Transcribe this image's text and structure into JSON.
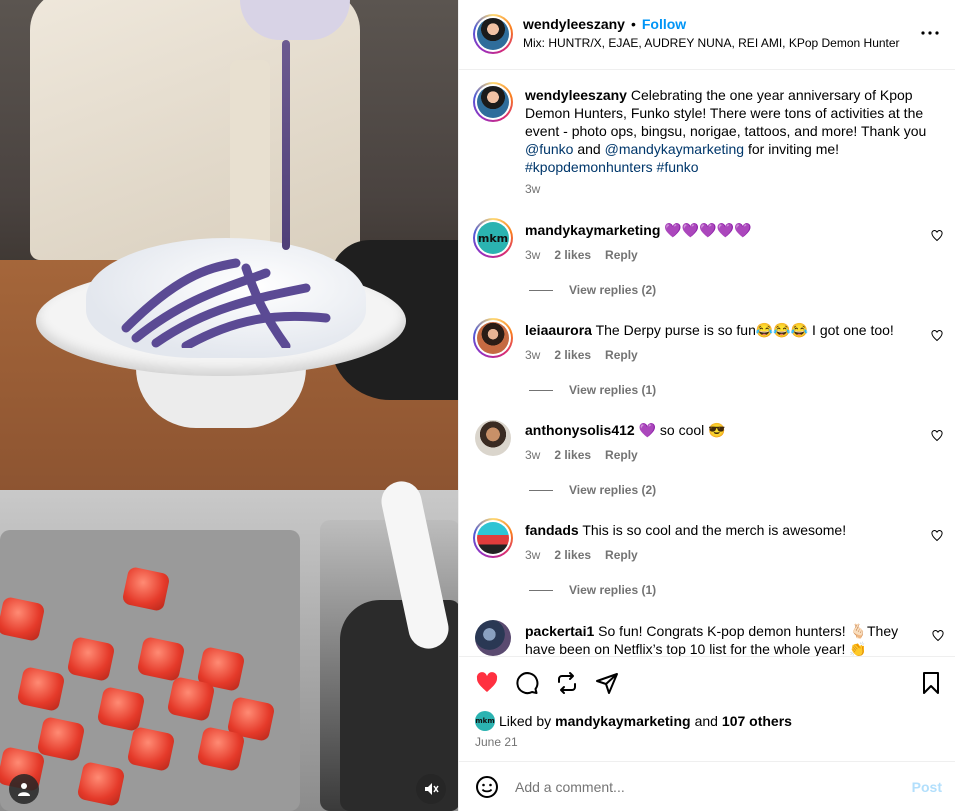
{
  "media": {
    "user_icon": "user-icon",
    "mute_icon": "speaker-muted-icon"
  },
  "header": {
    "username": "wendyleeszany",
    "dot": "•",
    "follow": "Follow",
    "audio": "Mix: HUNTR/X, EJAE, AUDREY NUNA, REI AMI, KPop Demon Hunter",
    "more_icon": "more-icon"
  },
  "caption": {
    "username": "wendyleeszany",
    "text1": "Celebrating the one year anniversary of Kpop Demon Hunters, Funko style! There were tons of activities at the event - photo ops, bingsu, norigae, tattoos, and more! Thank you ",
    "mention1": "@funko",
    "and": " and ",
    "mention2": "@mandykaymarketing",
    "text2": " for inviting me!",
    "tag1": "#kpopdemonhunters",
    "tag2": "#funko",
    "time": "3w"
  },
  "comments": [
    {
      "username": "mandykaymarketing",
      "text": "💜💜💜💜💜",
      "time": "3w",
      "likes": "2 likes",
      "reply": "Reply",
      "replies": "View replies (2)"
    },
    {
      "username": "leiaaurora",
      "text": "The Derpy purse is so fun😂😂😂 I got one too!",
      "time": "3w",
      "likes": "2 likes",
      "reply": "Reply",
      "replies": "View replies (1)"
    },
    {
      "username": "anthonysolis412",
      "text": "💜 so cool 😎",
      "time": "3w",
      "likes": "2 likes",
      "reply": "Reply",
      "replies": "View replies (2)"
    },
    {
      "username": "fandads",
      "text": "This is so cool and the merch is awesome!",
      "time": "3w",
      "likes": "2 likes",
      "reply": "Reply",
      "replies": "View replies (1)"
    },
    {
      "username": "packertai1",
      "text": "So fun! Congrats K-pop demon hunters! 🫰🏻They have been on Netflix’s top 10 list for the whole year! 👏"
    }
  ],
  "avatar_labels": {
    "mkm": "mkm"
  },
  "actions": {
    "liked_prefix": "Liked by ",
    "liked_user": "mandykaymarketing",
    "liked_and": " and ",
    "liked_count": "107 others",
    "date": "June 21",
    "like_color": "#ff3040"
  },
  "comment_box": {
    "placeholder": "Add a comment...",
    "post": "Post"
  }
}
